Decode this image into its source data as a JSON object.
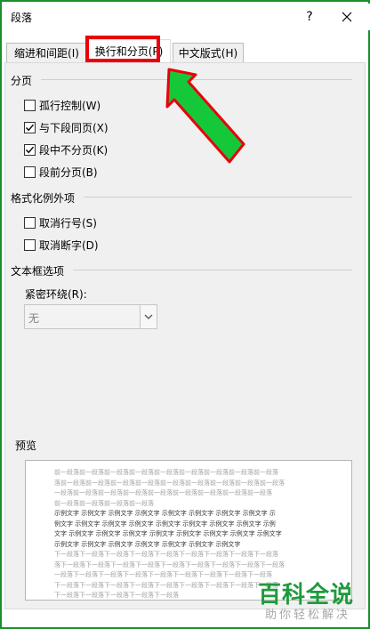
{
  "window": {
    "title": "段落",
    "help": "?",
    "close_icon": "close-icon"
  },
  "tabs": [
    {
      "label": "缩进和间距(I)"
    },
    {
      "label": "换行和分页(P)"
    },
    {
      "label": "中文版式(H)"
    }
  ],
  "pagination": {
    "title": "分页",
    "options": [
      {
        "label": "孤行控制(W)",
        "checked": false
      },
      {
        "label": "与下段同页(X)",
        "checked": true
      },
      {
        "label": "段中不分页(K)",
        "checked": true
      },
      {
        "label": "段前分页(B)",
        "checked": false
      }
    ]
  },
  "format_exceptions": {
    "title": "格式化例外项",
    "options": [
      {
        "label": "取消行号(S)",
        "checked": false
      },
      {
        "label": "取消断字(D)",
        "checked": false
      }
    ]
  },
  "textbox_options": {
    "title": "文本框选项",
    "wrap_label": "紧密环绕(R):",
    "wrap_value": "无"
  },
  "preview": {
    "title": "预览",
    "lines": [
      {
        "text": "前一段落前一段落前一段落前一段落前一段落前一段落前一段落前一段落前一段落",
        "style": "grey"
      },
      {
        "text": "落前一段落前一段落前一段落前一段落前一段落前一段落前一段落前一段落前一段落",
        "style": "grey"
      },
      {
        "text": "一段落前一段落前一段落前一段落前一段落前一段落前一段落前一段落前一段落",
        "style": "grey"
      },
      {
        "text": "前一段落前一段落前一段落前一段落",
        "style": "grey"
      },
      {
        "text": "示例文字 示例文字 示例文字 示例文字 示例文字 示例文字 示例文字 示例文字 示",
        "style": "dark"
      },
      {
        "text": "例文字 示例文字 示例文字 示例文字 示例文字 示例文字 示例文字 示例文字 示例",
        "style": "dark"
      },
      {
        "text": "文字 示例文字 示例文字 示例文字 示例文字 示例文字 示例文字 示例文字 示例文字",
        "style": "dark"
      },
      {
        "text": "示例文字 示例文字 示例文字 示例文字 示例文字 示例文字 示例文字",
        "style": "dark"
      },
      {
        "text": "下一段落下一段落下一段落下一段落下一段落下一段落下一段落下一段落下一段落",
        "style": "grey"
      },
      {
        "text": "落下一段落下一段落下一段落下一段落下一段落下一段落下一段落下一段落下一段落",
        "style": "grey"
      },
      {
        "text": "一段落下一段落下一段落下一段落下一段落下一段落下一段落下一段落下一段落",
        "style": "grey"
      },
      {
        "text": "下一段落下一段落下一段落下一段落下一段落下一段落下一段落下一段落下一段落",
        "style": "grey"
      },
      {
        "text": "下一段落下一段落下一段落下一段落下一段落",
        "style": "grey"
      }
    ]
  },
  "watermark": {
    "main": "百科全说",
    "sub": "助你轻松解决"
  },
  "colors": {
    "highlight": "#e8000b",
    "arrow": "#14c83a",
    "watermark": "#1e9b3c"
  }
}
